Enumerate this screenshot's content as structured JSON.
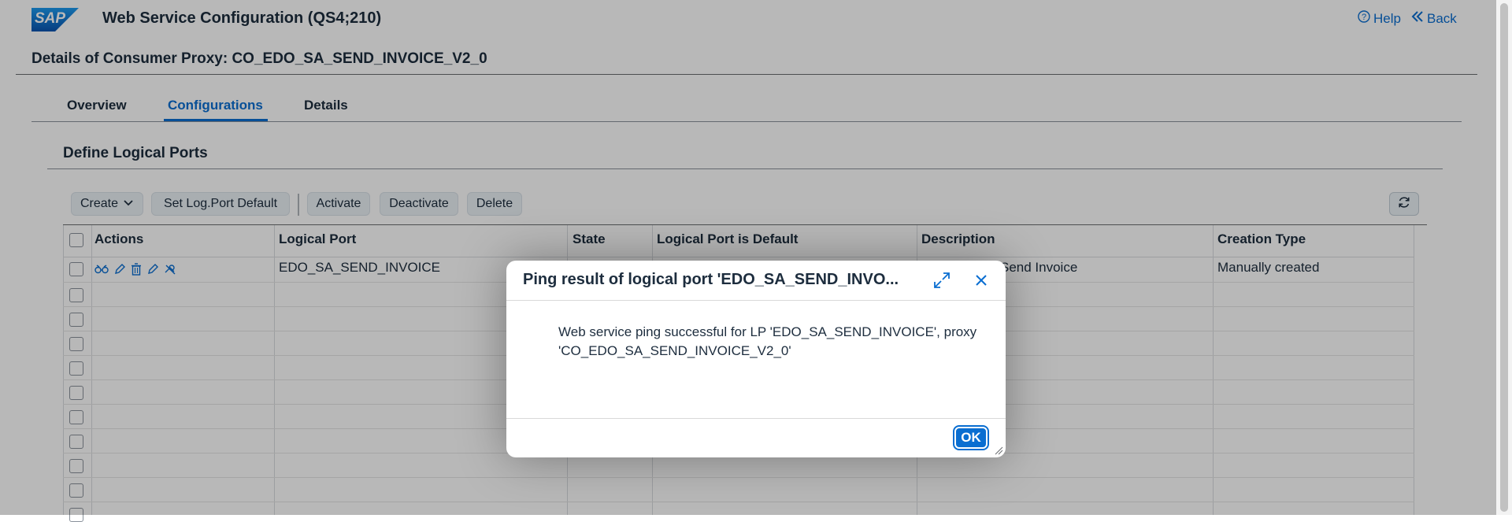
{
  "shell": {
    "logo_text": "SAP",
    "title": "Web Service Configuration (QS4;210)",
    "help_label": "Help",
    "back_label": "Back",
    "brand_color": "#0a6ed1"
  },
  "page": {
    "object_title": "Details of Consumer Proxy: CO_EDO_SA_SEND_INVOICE_V2_0",
    "tabs": [
      {
        "label": "Overview"
      },
      {
        "label": "Configurations",
        "active": true
      },
      {
        "label": "Details"
      }
    ],
    "section_title": "Define Logical Ports"
  },
  "toolbar": {
    "create_label": "Create",
    "set_default_label": "Set Log.Port Default",
    "activate_label": "Activate",
    "deactivate_label": "Deactivate",
    "delete_label": "Delete"
  },
  "table": {
    "columns": [
      "Actions",
      "Logical Port",
      "State",
      "Logical Port is Default",
      "Description",
      "Creation Type"
    ],
    "rows": [
      {
        "logical_port": "EDO_SA_SEND_INVOICE",
        "state": "",
        "is_default": "",
        "description": "Send Invoice",
        "creation_type": "Manually created",
        "action_icons": [
          "display-icon",
          "edit-icon",
          "delete-icon",
          "edit-icon",
          "ping-icon"
        ]
      }
    ]
  },
  "dialog": {
    "title": "Ping result of logical port 'EDO_SA_SEND_INVO...",
    "message": "Web service ping successful for LP 'EDO_SA_SEND_INVOICE', proxy 'CO_EDO_SA_SEND_INVOICE_V2_0'",
    "ok_label": "OK"
  }
}
